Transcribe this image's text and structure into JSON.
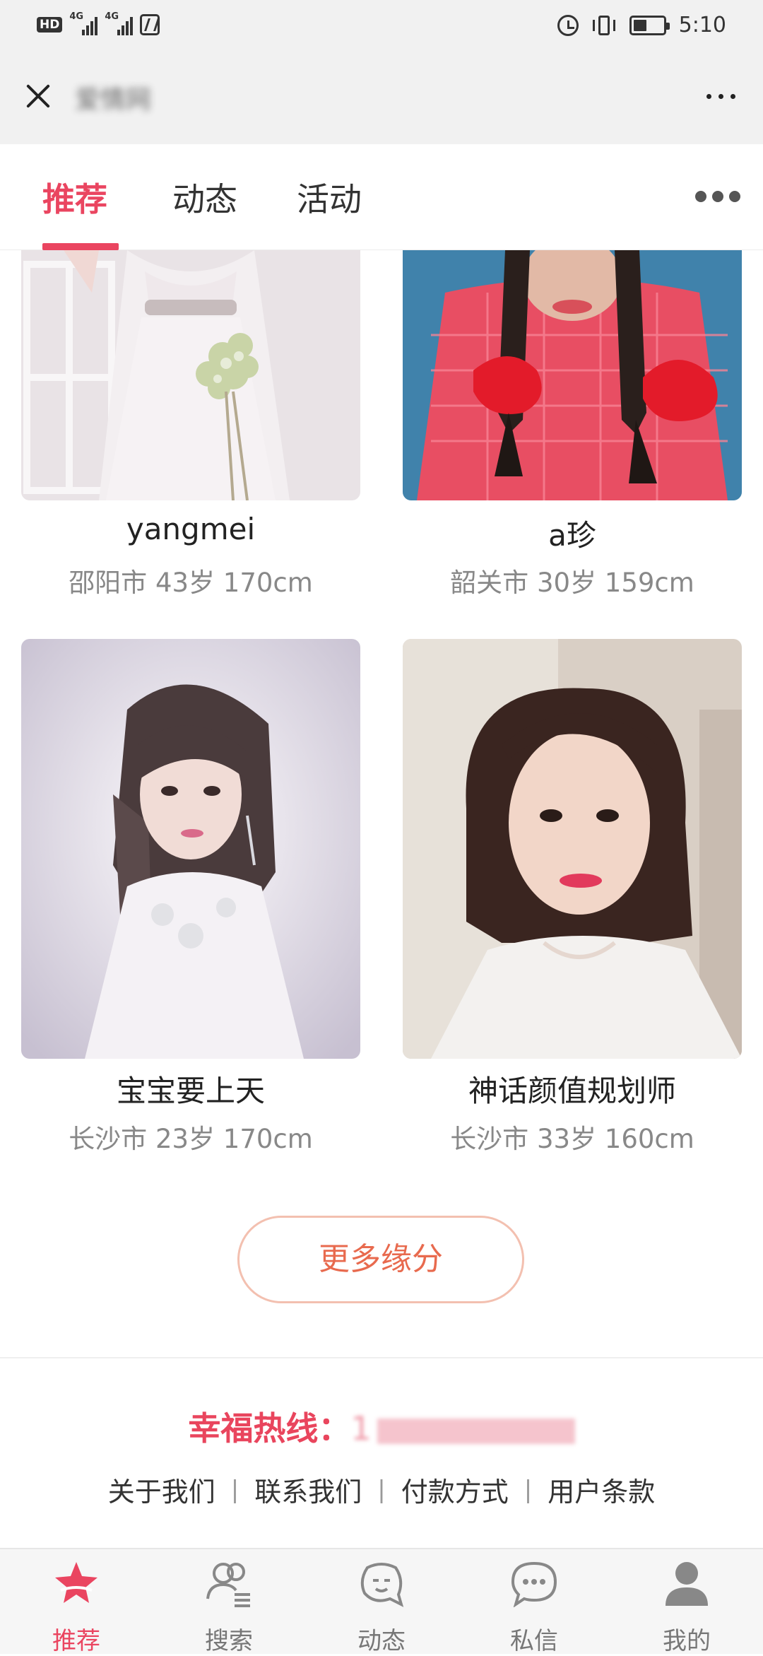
{
  "status_bar": {
    "hd": "HD",
    "net1": "4G",
    "net2": "4G",
    "time": "5:10",
    "battery_level": 0.45
  },
  "title_bar": {
    "title": "爱情网"
  },
  "tabs": [
    {
      "label": "推荐",
      "active": true
    },
    {
      "label": "动态",
      "active": false
    },
    {
      "label": "活动",
      "active": false
    }
  ],
  "profiles": [
    {
      "name": "yangmei",
      "info": "邵阳市 43岁 170cm"
    },
    {
      "name": "a珍",
      "info": "韶关市 30岁 159cm"
    },
    {
      "name": "宝宝要上天",
      "info": "长沙市 23岁 170cm"
    },
    {
      "name": "神话颜值规划师",
      "info": "长沙市 33岁 160cm"
    }
  ],
  "more_button": "更多缘分",
  "footer": {
    "hotline_label": "幸福热线：",
    "hotline_number": "1",
    "links": [
      "关于我们",
      "联系我们",
      "付款方式",
      "用户条款"
    ]
  },
  "bottom_nav": [
    {
      "label": "推荐",
      "icon": "star-icon",
      "active": true
    },
    {
      "label": "搜索",
      "icon": "search-people-icon",
      "active": false
    },
    {
      "label": "动态",
      "icon": "moments-icon",
      "active": false
    },
    {
      "label": "私信",
      "icon": "chat-icon",
      "active": false
    },
    {
      "label": "我的",
      "icon": "profile-icon",
      "active": false
    }
  ],
  "colors": {
    "accent": "#ea4560",
    "button_text": "#e86a4e",
    "button_border": "#f3c0b0"
  }
}
